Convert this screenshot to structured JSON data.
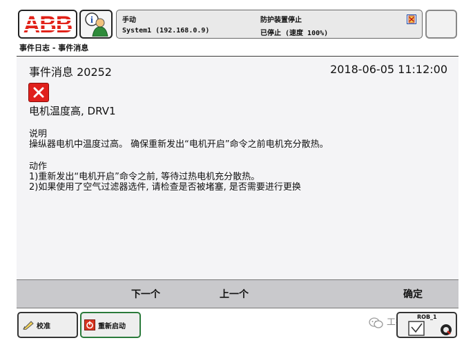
{
  "status_bar": {
    "logo": "ABB",
    "mode": "手动",
    "system": "System1 (192.168.0.9)",
    "safety": "防护装置停止",
    "run_state": "已停止 (速度 100%)"
  },
  "breadcrumb": "事件日志 - 事件消息",
  "message": {
    "title": "事件消息 20252",
    "timestamp": "2018-06-05 11:12:00",
    "severity_icon": "error-x-icon",
    "headline": "电机温度高, DRV1",
    "description_heading": "说明",
    "description": "操纵器电机中温度过高。 确保重新发出“电机开启”命令之前电机充分散热。",
    "actions_heading": "动作",
    "actions": [
      "1)重新发出“电机开启”命令之前, 等待过热电机充分散热。",
      "2)如果使用了空气过滤器选件, 请检查是否被堵塞, 是否需要进行更换"
    ]
  },
  "commands": {
    "next": "下一个",
    "previous": "上一个",
    "ok": "确定"
  },
  "taskbar": {
    "calibrate": "校准",
    "restart": "重新启动",
    "quickset_label": "ROB_1",
    "watermark": "工控大学堂"
  },
  "colors": {
    "error_red": "#e0201c",
    "abb_red": "#e2231a",
    "content_bg": "#f4f4f6",
    "command_bar": "#c9c9cc"
  }
}
